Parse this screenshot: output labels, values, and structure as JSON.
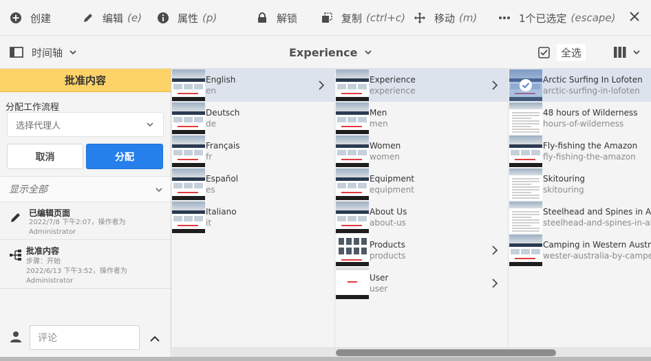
{
  "toolbar": {
    "create": "创建",
    "edit": "编辑",
    "edit_kbd": "(e)",
    "properties": "属性",
    "properties_kbd": "(p)",
    "unlock": "解锁",
    "copy": "复制",
    "copy_kbd": "(ctrl+c)",
    "move": "移动",
    "move_kbd": "(m)",
    "selected": "1个已选定",
    "selected_kbd": "(escape)"
  },
  "subbar": {
    "rail_view": "时间轴",
    "title": "Experience",
    "select_all": "全选"
  },
  "rail": {
    "header": "批准内容",
    "workflow_label": "分配工作流程",
    "assignee_placeholder": "选择代理人",
    "cancel": "取消",
    "assign": "分配",
    "show_all": "显示全部",
    "items": [
      {
        "title": "已编辑页面",
        "meta1": "2022/7/8 下午2:07，操作者为",
        "meta2": "Administrator"
      },
      {
        "title": "批准内容",
        "meta0": "步骤：开始",
        "meta1": "2022/6/13 下午3:52，操作者为",
        "meta2": "Administrator"
      }
    ],
    "comment_placeholder": "评论"
  },
  "columns": {
    "col1": [
      {
        "title": "English",
        "name": "en",
        "children": true,
        "selected": true
      },
      {
        "title": "Deutsch",
        "name": "de"
      },
      {
        "title": "Français",
        "name": "fr"
      },
      {
        "title": "Español",
        "name": "es"
      },
      {
        "title": "Italiano",
        "name": "it"
      }
    ],
    "col2": [
      {
        "title": "Experience",
        "name": "experience",
        "children": true,
        "selected": true
      },
      {
        "title": "Men",
        "name": "men"
      },
      {
        "title": "Women",
        "name": "women"
      },
      {
        "title": "Equipment",
        "name": "equipment"
      },
      {
        "title": "About Us",
        "name": "about-us"
      },
      {
        "title": "Products",
        "name": "products",
        "children": true
      },
      {
        "title": "User",
        "name": "user",
        "children": true
      }
    ],
    "col3": [
      {
        "title": "Arctic Surfing In Lofoten",
        "name": "arctic-surfing-in-lofoten",
        "selected": true
      },
      {
        "title": "48 hours of Wilderness",
        "name": "hours-of-wilderness"
      },
      {
        "title": "Fly-fishing the Amazon",
        "name": "fly-fishing-the-amazon"
      },
      {
        "title": "Skitouring",
        "name": "skitouring"
      },
      {
        "title": "Steelhead and Spines in Ala",
        "name": "steelhead-and-spines-in-ala"
      },
      {
        "title": "Camping in Western Austra",
        "name": "wester-australia-by-camper"
      }
    ]
  }
}
